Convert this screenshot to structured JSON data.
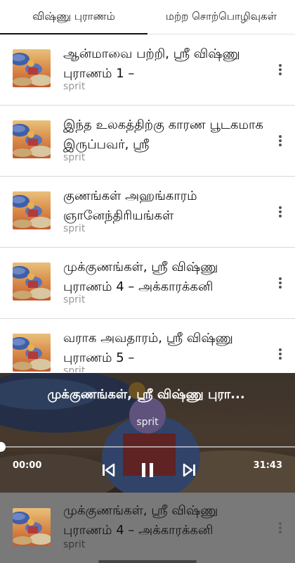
{
  "tabs": [
    {
      "label": "விஷ்ணு புராணம்",
      "active": true
    },
    {
      "label": "மற்ற சொற்பொழிவுகள்",
      "active": false
    }
  ],
  "list": {
    "items": [
      {
        "title": "ஆன்மாவை பற்றி, ஸ்ரீ விஷ்ணு புராணம் 1 –",
        "subtitle": "sprit"
      },
      {
        "title": "இந்த உலகத்திற்கு காரண பூடகமாக இருப்பவர், ஸ்ரீ",
        "subtitle": "sprit"
      },
      {
        "title": "குணங்கள் அஹங்காரம் ஞானேந்திரியங்கள்",
        "subtitle": "sprit"
      },
      {
        "title": "முக்குணங்கள், ஸ்ரீ விஷ்ணு புராணம் 4 – அக்காரக்கனி",
        "subtitle": "sprit"
      },
      {
        "title": "வராக அவதாரம், ஸ்ரீ விஷ்ணு புராணம் 5 –",
        "subtitle": "sprit"
      }
    ]
  },
  "player": {
    "title": "முக்குணங்கள், ஸ்ரீ விஷ்ணு புரா...",
    "subtitle": "sprit",
    "time_current": "00:00",
    "time_total": "31:43",
    "progress": 0
  },
  "mini_player": {
    "title": "முக்குணங்கள், ஸ்ரீ விஷ்ணு புராணம் 4 – அக்காரக்கனி",
    "subtitle": "sprit"
  },
  "colors": {
    "accent": "#111111",
    "subtitle": "#9a9a9a",
    "mini_player_bg": "#797979"
  }
}
